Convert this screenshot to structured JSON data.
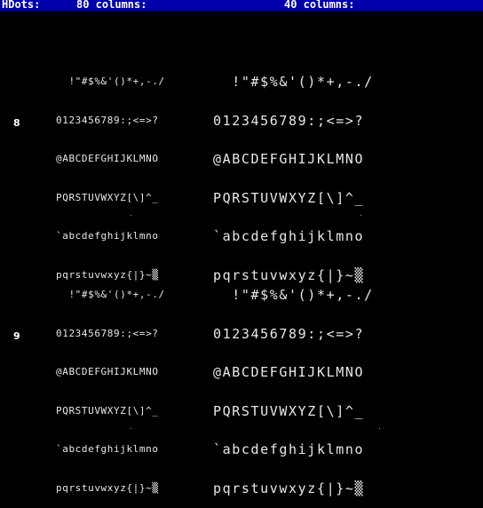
{
  "header": {
    "label": "HDots:",
    "col80": "80 columns:",
    "col40": "40 columns:"
  },
  "rows": [
    {
      "label": "8",
      "lines": [
        "  !\"#$%&'()*+,-./",
        "0123456789:;<=>?",
        "@ABCDEFGHIJKLMNO",
        "PQRSTUVWXYZ[\\]^_",
        "`abcdefghijklmno",
        "pqrstuvwxyz{|}~▒"
      ]
    },
    {
      "label": "9",
      "lines": [
        "  !\"#$%&'()*+,-./",
        "0123456789:;<=>?",
        "@ABCDEFGHIJKLMNO",
        "PQRSTUVWXYZ[\\]^_",
        "`abcdefghijklmno",
        "pqrstuvwxyz{|}~▒"
      ]
    }
  ],
  "colors": {
    "header_bg": "#0000aa",
    "header_text": "#ffffff",
    "background": "#000000",
    "glyph": "#e8e8e8"
  }
}
